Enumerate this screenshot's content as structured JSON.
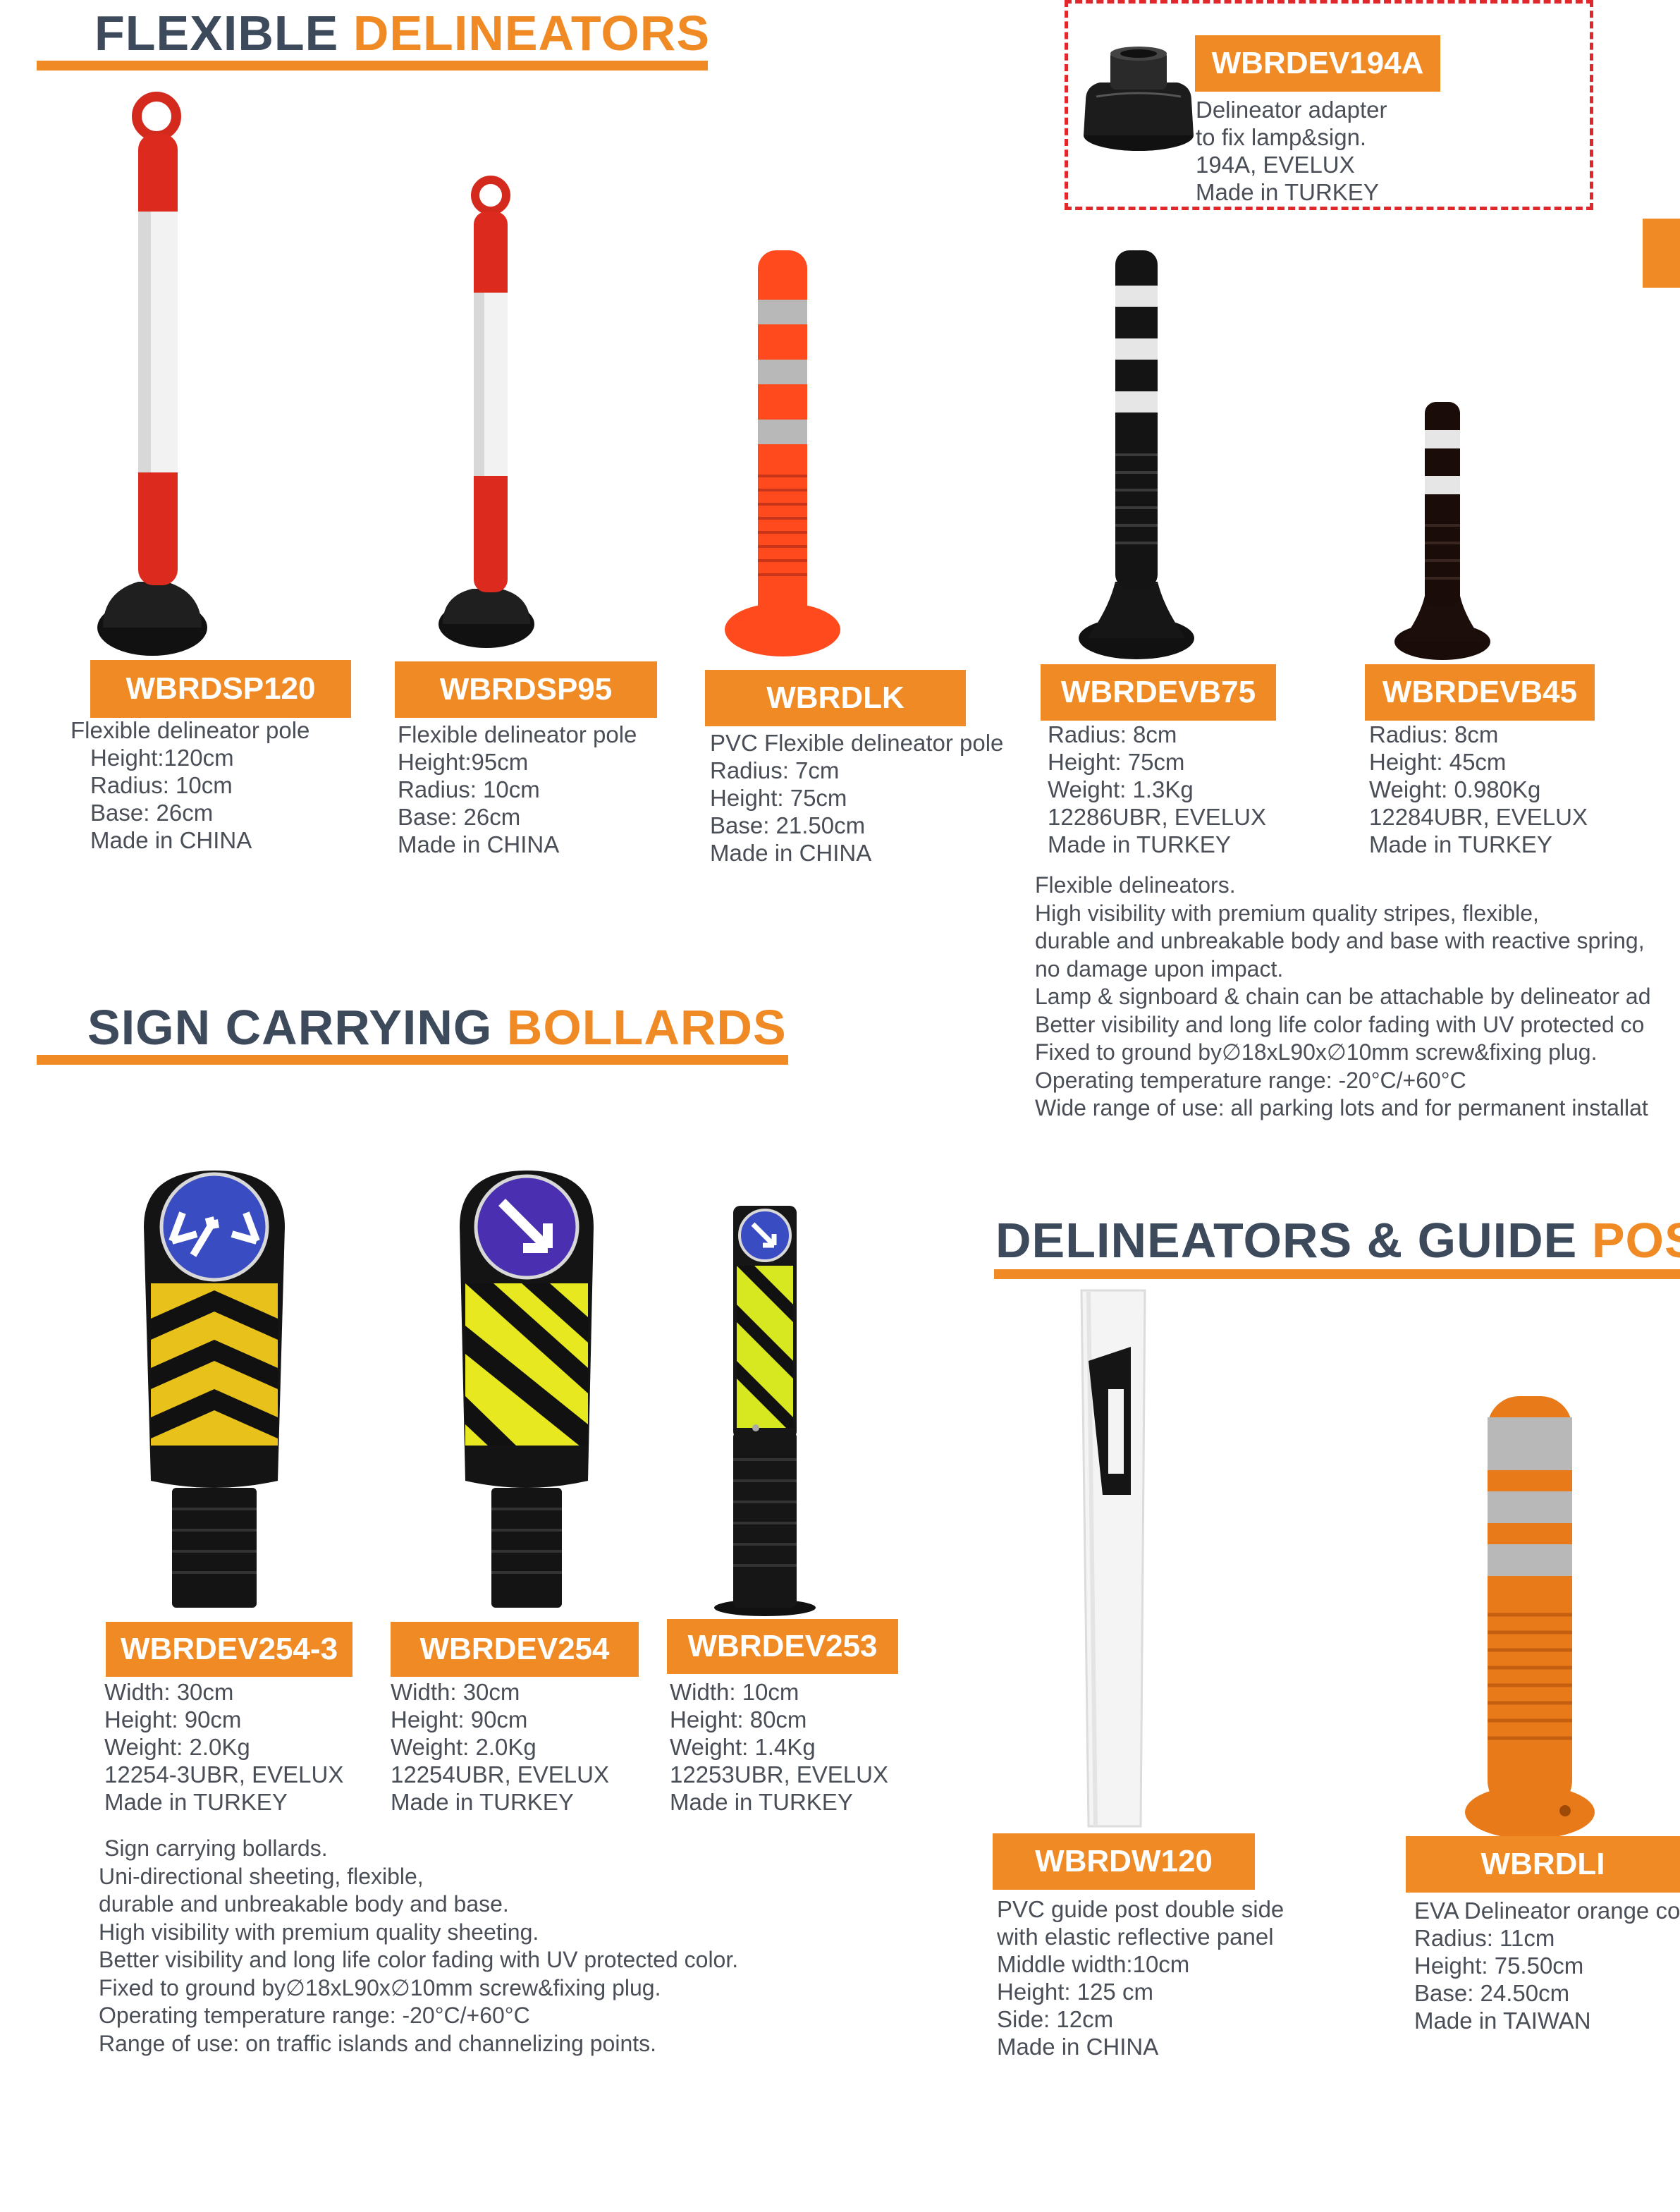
{
  "sections": {
    "flexible": {
      "title_part1": "FLEXIBLE",
      "title_part2": "DELINEATORS"
    },
    "sign": {
      "title_part1": "SIGN CARRYING",
      "title_part2": "BOLLARDS"
    },
    "guide": {
      "title_part1": "DELINEATORS & GUIDE",
      "title_part2": "POS"
    }
  },
  "adapter": {
    "code": "WBRDEV194A",
    "lines": [
      "Delineator adapter",
      "to fix lamp&sign.",
      "194A, EVELUX",
      "Made in TURKEY"
    ]
  },
  "flexible_products": [
    {
      "code": "WBRDSP120",
      "lines": [
        "Flexible delineator pole",
        "Height:120cm",
        "Radius: 10cm",
        "Base: 26cm",
        "Made in CHINA"
      ]
    },
    {
      "code": "WBRDSP95",
      "lines": [
        "Flexible delineator pole",
        "Height:95cm",
        "Radius: 10cm",
        "Base: 26cm",
        "Made in CHINA"
      ]
    },
    {
      "code": "WBRDLK",
      "lines": [
        "PVC Flexible delineator pole",
        "Radius: 7cm",
        "Height: 75cm",
        "Base: 21.50cm",
        "Made in CHINA"
      ]
    },
    {
      "code": "WBRDEVB75",
      "lines": [
        "Radius: 8cm",
        "Height: 75cm",
        "Weight: 1.3Kg",
        "12286UBR, EVELUX",
        "Made in TURKEY"
      ]
    },
    {
      "code": "WBRDEVB45",
      "lines": [
        "Radius: 8cm",
        "Height: 45cm",
        "Weight: 0.980Kg",
        "12284UBR, EVELUX",
        "Made in TURKEY"
      ]
    }
  ],
  "flexible_para": [
    "Flexible delineators.",
    "High visibility with premium quality stripes, flexible,",
    "durable and unbreakable body and base with reactive spring,",
    "no damage upon impact.",
    "Lamp & signboard & chain can be attachable by delineator ad",
    "Better visibility and long life color fading with UV protected co",
    "Fixed to ground by∅18xL90x∅10mm screw&fixing plug.",
    "Operating temperature range: -20°C/+60°C",
    "Wide range of use: all parking lots and for permanent installat"
  ],
  "sign_products": [
    {
      "code": "WBRDEV254-3",
      "lines": [
        "Width: 30cm",
        "Height: 90cm",
        "Weight: 2.0Kg",
        "12254-3UBR, EVELUX",
        "Made in TURKEY"
      ]
    },
    {
      "code": "WBRDEV254",
      "lines": [
        "Width: 30cm",
        "Height: 90cm",
        "Weight: 2.0Kg",
        "12254UBR, EVELUX",
        "Made in TURKEY"
      ]
    },
    {
      "code": "WBRDEV253",
      "lines": [
        "Width: 10cm",
        "Height: 80cm",
        "Weight: 1.4Kg",
        "12253UBR, EVELUX",
        "Made in TURKEY"
      ]
    }
  ],
  "sign_para": [
    "Sign carrying bollards.",
    "Uni-directional sheeting, flexible,",
    "durable and unbreakable body and base.",
    "High visibility with premium quality sheeting.",
    "Better visibility and long life color fading with UV protected color.",
    "Fixed to ground by∅18xL90x∅10mm screw&fixing plug.",
    "Operating temperature range: -20°C/+60°C",
    "Range of use: on traffic islands and channelizing points."
  ],
  "guide_products": [
    {
      "code": "WBRDW120",
      "lines": [
        "PVC guide post double side",
        "with elastic reflective panel",
        "Middle width:10cm",
        "Height: 125 cm",
        "Side: 12cm",
        "Made in CHINA"
      ]
    },
    {
      "code": "WBRDLI",
      "lines": [
        "EVA Delineator orange co",
        "Radius: 11cm",
        "Height: 75.50cm",
        "Base: 24.50cm",
        "Made in TAIWAN"
      ]
    }
  ],
  "colors": {
    "accent": "#f08a24",
    "heading": "#3d4a5c",
    "text": "#4a4f57",
    "dashed_border": "#e0282c"
  }
}
